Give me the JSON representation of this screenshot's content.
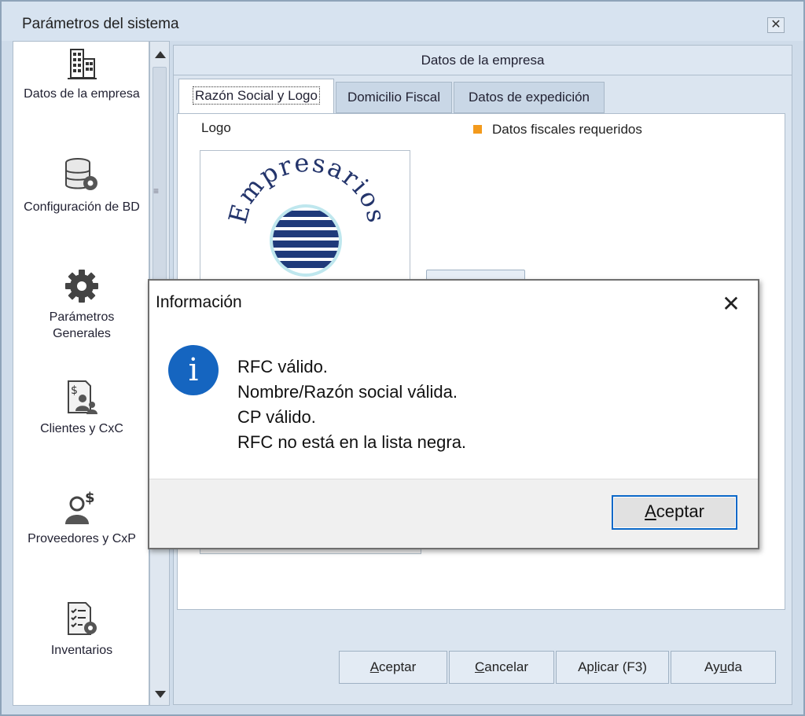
{
  "window": {
    "title": "Parámetros del sistema",
    "close_glyph": "✕"
  },
  "sidebar": {
    "items": [
      {
        "label": "Datos de la empresa",
        "icon": "building-icon"
      },
      {
        "label": "Configuración de BD",
        "icon": "database-gear-icon"
      },
      {
        "label": "Parámetros\nGenerales",
        "label_line1": "Parámetros",
        "label_line2": "Generales",
        "icon": "gear-icon"
      },
      {
        "label": "Clientes y CxC",
        "icon": "clients-money-icon"
      },
      {
        "label": "Proveedores y CxP",
        "icon": "supplier-money-icon"
      },
      {
        "label": "Inventarios",
        "icon": "inventory-checklist-icon"
      }
    ]
  },
  "main": {
    "section_title": "Datos de la empresa",
    "tabs": [
      {
        "label": "Razón Social y Logo",
        "active": true
      },
      {
        "label": "Domicilio Fiscal",
        "active": false
      },
      {
        "label": "Datos de expedición",
        "active": false
      }
    ],
    "logo_label": "Logo",
    "required_legend": "Datos fiscales requeridos",
    "logo_text": "Empresarios",
    "required_color": "#f39a1c"
  },
  "footer": {
    "accept_prefix": "",
    "accept_key": "A",
    "accept_rest": "ceptar",
    "cancel_key": "C",
    "cancel_rest": "ancelar",
    "apply_prefix": "Ap",
    "apply_key": "l",
    "apply_rest": "icar (F3)",
    "help_prefix": "Ay",
    "help_key": "u",
    "help_rest": "da"
  },
  "dialog": {
    "title": "Información",
    "close_glyph": "✕",
    "icon_glyph": "i",
    "messages": [
      "RFC válido.",
      "Nombre/Razón social válida.",
      "CP válido.",
      "RFC no está en la lista negra."
    ],
    "ok_key": "A",
    "ok_rest": "ceptar",
    "accent": "#0a68c8"
  }
}
